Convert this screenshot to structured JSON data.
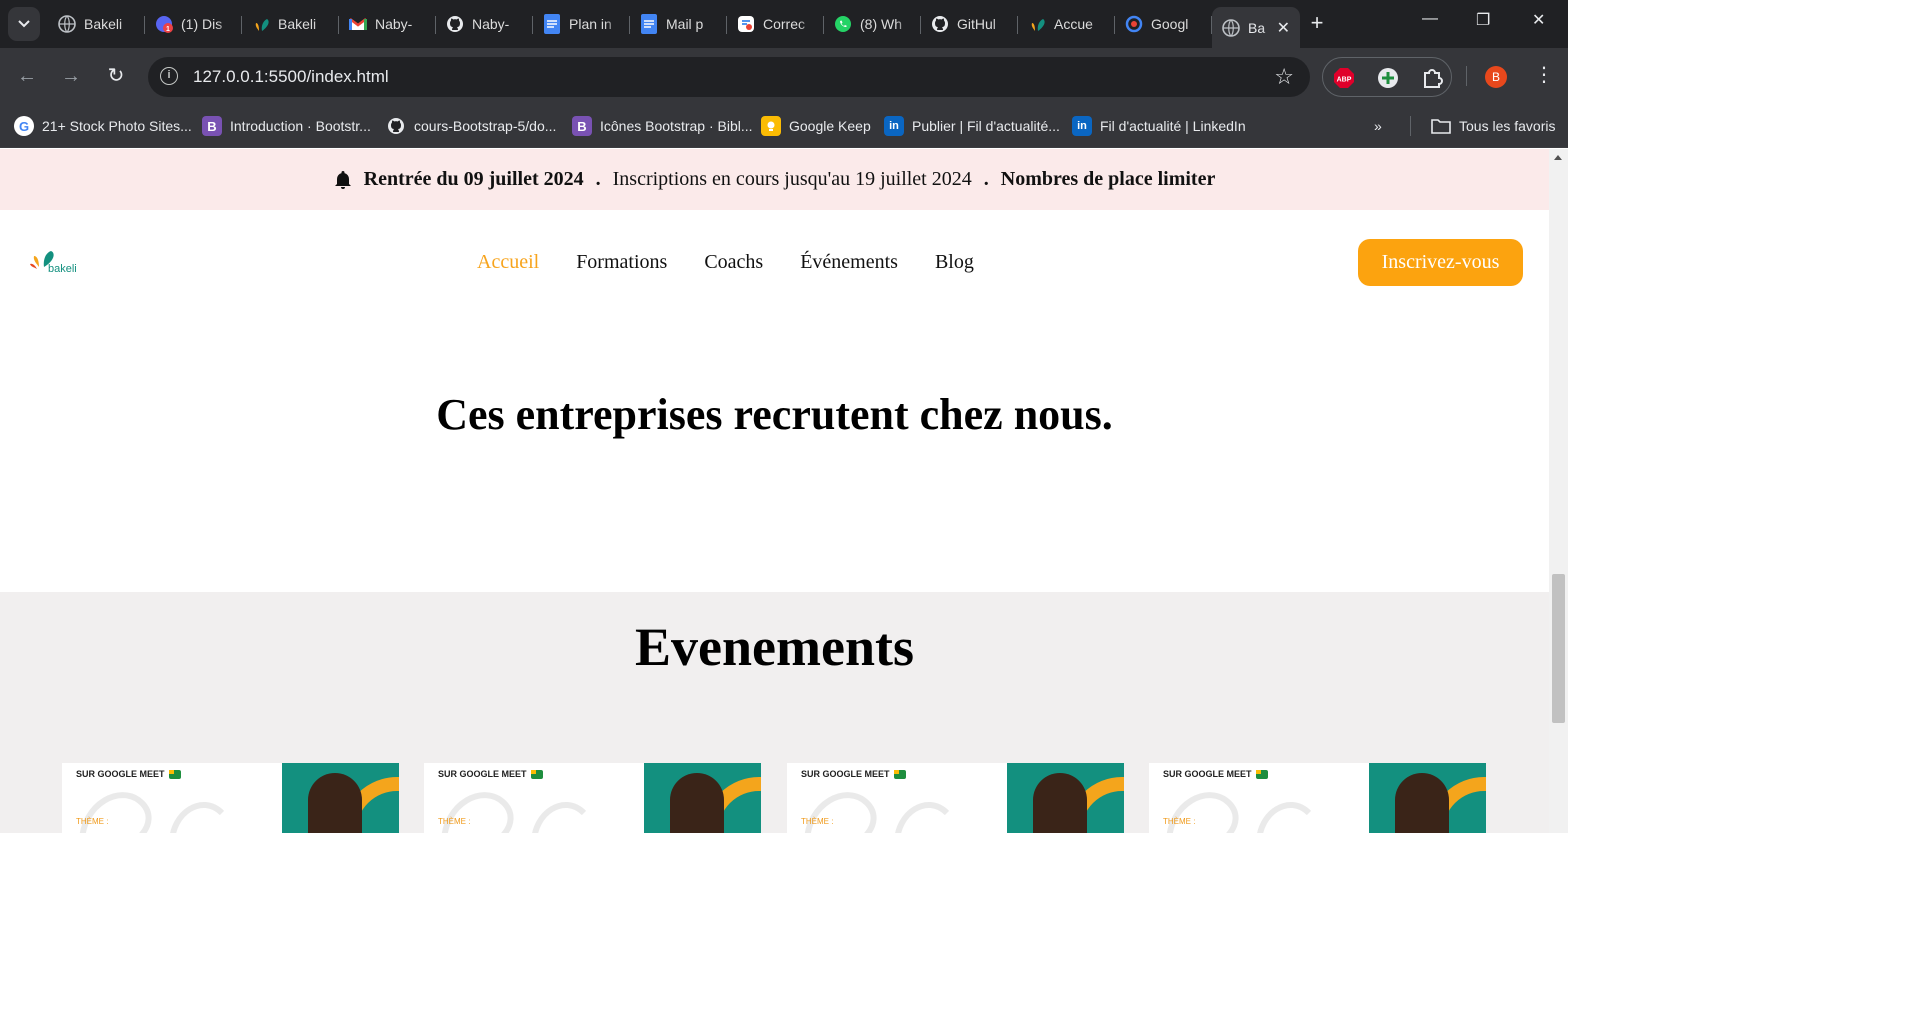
{
  "browser": {
    "tabs": [
      {
        "title": "Bakeli",
        "icon": "globe-icon"
      },
      {
        "title": "(1) Dis",
        "icon": "discord-icon"
      },
      {
        "title": "Bakeli",
        "icon": "bakeli-icon"
      },
      {
        "title": "Naby-",
        "icon": "gmail-icon"
      },
      {
        "title": "Naby-",
        "icon": "github-icon"
      },
      {
        "title": "Plan in",
        "icon": "docs-icon"
      },
      {
        "title": "Mail p",
        "icon": "docs-icon"
      },
      {
        "title": "Correc",
        "icon": "translate-icon"
      },
      {
        "title": "(8) Wh",
        "icon": "whatsapp-icon"
      },
      {
        "title": "GitHul",
        "icon": "github-icon"
      },
      {
        "title": "Accue",
        "icon": "bakeli-icon"
      },
      {
        "title": "Googl",
        "icon": "google-lens-icon"
      },
      {
        "title": "Ba",
        "icon": "globe-icon",
        "active": true
      }
    ],
    "url": "127.0.0.1:5500/index.html",
    "profile_initial": "B",
    "bookmarks": [
      {
        "label": "21+ Stock Photo Sites...",
        "icon": "google-icon"
      },
      {
        "label": "Introduction · Bootstr...",
        "icon": "bootstrap-icon"
      },
      {
        "label": "cours-Bootstrap-5/do...",
        "icon": "github-icon"
      },
      {
        "label": "Icônes Bootstrap · Bibl...",
        "icon": "bootstrap-icon"
      },
      {
        "label": "Google Keep",
        "icon": "keep-icon"
      },
      {
        "label": "Publier | Fil d'actualité...",
        "icon": "linkedin-icon"
      },
      {
        "label": "Fil d'actualité | LinkedIn",
        "icon": "linkedin-icon"
      }
    ],
    "all_bookmarks_label": "Tous les favoris"
  },
  "announcement": {
    "start": "Rentrée du 09 juillet 2024",
    "separator": ".",
    "registration": "Inscriptions en cours jusqu'au 19 juillet 2024",
    "places": "Nombres de place limiter"
  },
  "nav": {
    "logo_text": "bakeli",
    "items": [
      "Accueil",
      "Formations",
      "Coachs",
      "Événements",
      "Blog"
    ],
    "cta": "Inscrivez-vous"
  },
  "recruit_heading": "Ces entreprises recrutent chez nous.",
  "events": {
    "heading": "Evenements",
    "cards": [
      {
        "meet_label": "SUR GOOGLE MEET",
        "theme_label": "THÈME :"
      },
      {
        "meet_label": "SUR GOOGLE MEET",
        "theme_label": "THÈME :"
      },
      {
        "meet_label": "SUR GOOGLE MEET",
        "theme_label": "THÈME :"
      },
      {
        "meet_label": "SUR GOOGLE MEET",
        "theme_label": "THÈME :"
      }
    ]
  },
  "colors": {
    "accent": "#fca30f",
    "announce_bg": "#fbeaea",
    "events_bg": "#f1efef",
    "brand_teal": "#13907f"
  }
}
